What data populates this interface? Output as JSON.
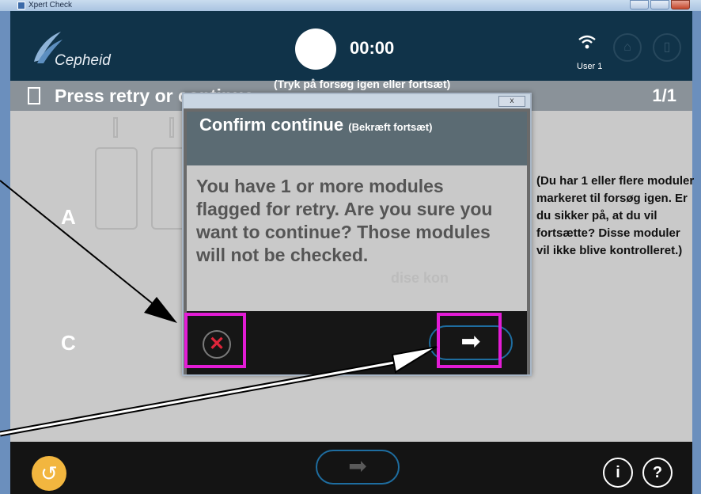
{
  "window": {
    "title": "Xpert Check"
  },
  "header": {
    "logo_text": "Cepheid",
    "timer": "00:00",
    "user": "User 1",
    "home_icon": "home-icon",
    "exit_icon": "exit-door-icon",
    "wifi_icon": "wifi-icon"
  },
  "subbar": {
    "title": "Press retry or continue",
    "page": "1/1"
  },
  "rows": {
    "a": "A",
    "c": "C"
  },
  "annotations": {
    "top_translation": "(Tryk på forsøg igen eller fortsæt)",
    "side_translation": "(Du har 1 eller flere moduler markeret til forsøg igen. Er du sikker på, at du vil fortsætte? Disse moduler vil ikke blive kontrolleret.)"
  },
  "dialog": {
    "close_label": "x",
    "title": "Confirm continue",
    "title_translation": "(Bekræft fortsæt)",
    "message": "You have 1 or more modules flagged for retry.  Are you sure you want to continue?  Those modules will not be checked.",
    "ghost_text": "dise kon",
    "cancel_label": "✕",
    "continue_label": "➡"
  },
  "footer": {
    "undo_label": "↺",
    "next_label": "➡",
    "info_label": "i",
    "help_label": "?"
  },
  "colors": {
    "header_bg": "#103349",
    "highlight": "#e31cd6",
    "cancel_red": "#e0253a",
    "undo_orange": "#f2b63f",
    "pill_blue": "#1e6da0"
  }
}
